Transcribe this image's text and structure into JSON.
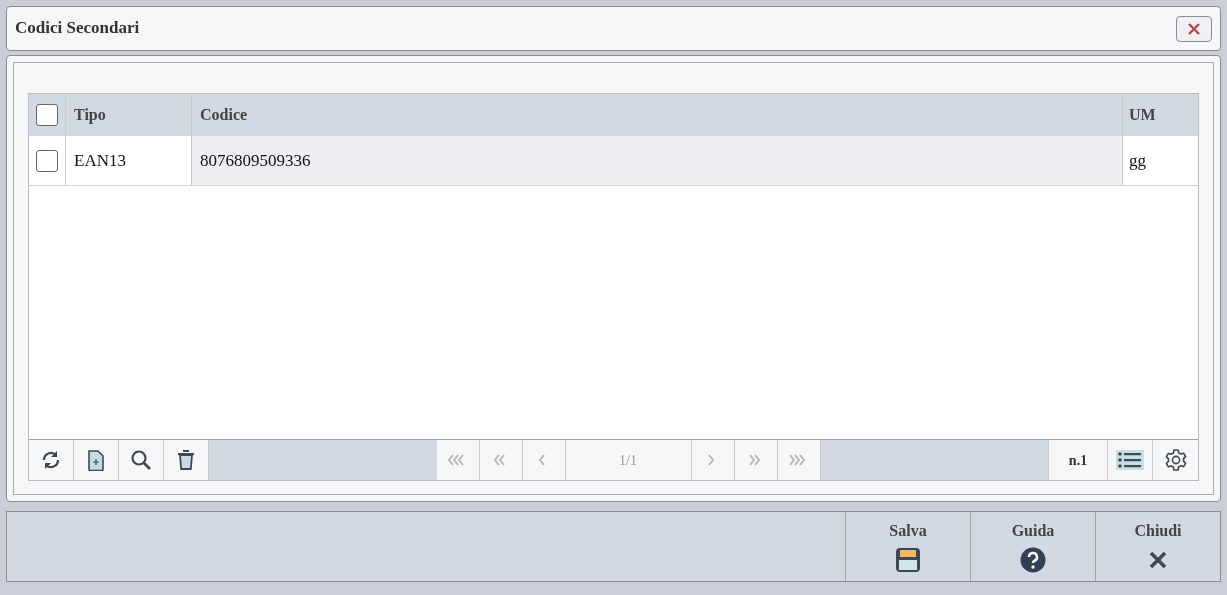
{
  "window": {
    "title": "Codici Secondari"
  },
  "table": {
    "select_all": {
      "checked": false
    },
    "columns": [
      "Tipo",
      "Codice",
      "UM"
    ],
    "rows": [
      {
        "checked": false,
        "cells": [
          "EAN13",
          "8076809509336",
          "gg"
        ]
      }
    ]
  },
  "toolbar": {
    "tools": [
      {
        "kind": "refresh"
      },
      {
        "kind": "new"
      },
      {
        "kind": "search"
      },
      {
        "kind": "delete"
      }
    ],
    "pager": [
      {
        "kind": "first",
        "disabled": true
      },
      {
        "kind": "prev-many",
        "disabled": true
      },
      {
        "kind": "prev",
        "disabled": true
      },
      {
        "kind": "page",
        "label": "1/1"
      },
      {
        "kind": "next",
        "disabled": true
      },
      {
        "kind": "next-many",
        "disabled": true
      },
      {
        "kind": "last",
        "disabled": true
      }
    ],
    "count": "n.1",
    "list_view": {
      "selected": true
    }
  },
  "footer": {
    "buttons": [
      {
        "kind": "save",
        "label": "Salva"
      },
      {
        "kind": "help",
        "label": "Guida"
      },
      {
        "kind": "close",
        "label": "Chiudi"
      }
    ]
  }
}
